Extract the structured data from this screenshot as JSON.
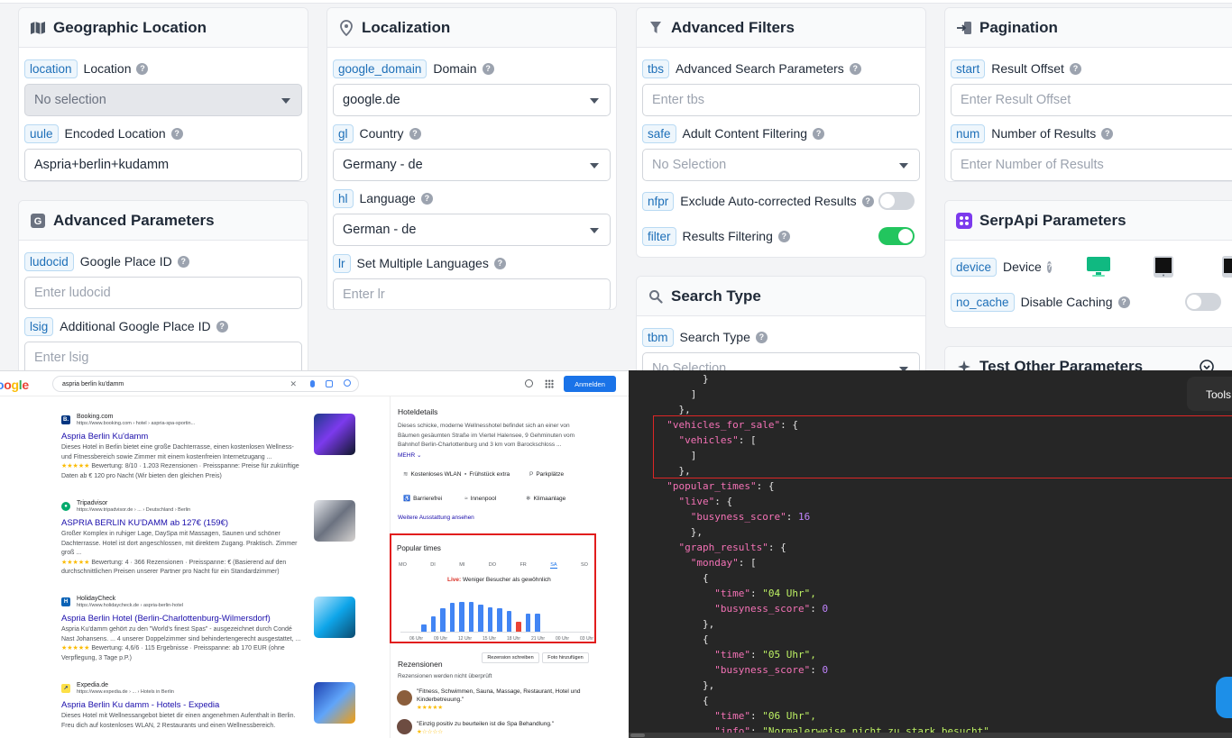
{
  "cards": {
    "geo": {
      "title": "Geographic Location",
      "location_code": "location",
      "location_label": "Location",
      "location_value": "No selection",
      "uule_code": "uule",
      "uule_label": "Encoded Location",
      "uule_value": "Aspria+berlin+kudamm"
    },
    "adv": {
      "title": "Advanced Parameters",
      "ludocid_code": "ludocid",
      "ludocid_label": "Google Place ID",
      "ludocid_placeholder": "Enter ludocid",
      "lsig_code": "lsig",
      "lsig_label": "Additional Google Place ID",
      "lsig_placeholder": "Enter lsig"
    },
    "loc": {
      "title": "Localization",
      "domain_code": "google_domain",
      "domain_label": "Domain",
      "domain_value": "google.de",
      "gl_code": "gl",
      "gl_label": "Country",
      "gl_value": "Germany - de",
      "hl_code": "hl",
      "hl_label": "Language",
      "hl_value": "German - de",
      "lr_code": "lr",
      "lr_label": "Set Multiple Languages",
      "lr_placeholder": "Enter lr"
    },
    "filters": {
      "title": "Advanced Filters",
      "tbs_code": "tbs",
      "tbs_label": "Advanced Search Parameters",
      "tbs_placeholder": "Enter tbs",
      "safe_code": "safe",
      "safe_label": "Adult Content Filtering",
      "safe_value": "No Selection",
      "nfpr_code": "nfpr",
      "nfpr_label": "Exclude Auto-corrected Results",
      "nfpr_on": false,
      "filter_code": "filter",
      "filter_label": "Results Filtering",
      "filter_on": true
    },
    "stype": {
      "title": "Search Type",
      "tbm_code": "tbm",
      "tbm_label": "Search Type",
      "tbm_value": "No Selection"
    },
    "pag": {
      "title": "Pagination",
      "start_code": "start",
      "start_label": "Result Offset",
      "start_placeholder": "Enter Result Offset",
      "num_code": "num",
      "num_label": "Number of Results",
      "num_placeholder": "Enter Number of Results"
    },
    "serpapi": {
      "title": "SerpApi Parameters",
      "device_code": "device",
      "device_label": "Device",
      "nocache_code": "no_cache",
      "nocache_label": "Disable Caching",
      "nocache_on": false
    },
    "test": {
      "title": "Test Other Parameters"
    }
  },
  "serp": {
    "logo": "oogle",
    "query": "aspria berlin ku'damm",
    "signin": "Anmelden",
    "results": [
      {
        "site": "Booking.com",
        "url": "https://www.booking.com › hotel › aspria-spa-sportin...",
        "title": "Aspria Berlin Ku'damm",
        "snippet": "Dieses Hotel in Berlin bietet eine große Dachterrasse, einen kostenlosen Wellness- und Fitnessbereich sowie Zimmer mit einem kostenfreien Internetzugang ...",
        "stars": "★★★★★",
        "meta": "Bewertung: 8/10 · 1.203 Rezensionen · Preisspanne: Preise für zukünftige Daten ab € 120 pro Nacht (Wir bieten den gleichen Preis)"
      },
      {
        "site": "Tripadvisor",
        "url": "https://www.tripadvisor.de › ... › Deutschland › Berlin",
        "title": "ASPRIA BERLIN KU'DAMM ab 127€ (159€)",
        "snippet": "Großer Komplex in ruhiger Lage, DaySpa mit Massagen, Saunen und schöner Dachterrasse. Hotel ist dort angeschlossen, mit direktem Zugang. Praktisch. Zimmer groß ...",
        "stars": "★★★★★",
        "meta": "Bewertung: 4 · 366 Rezensionen · Preisspanne: € (Basierend auf den durchschnittlichen Preisen unserer Partner pro Nacht für ein Standardzimmer)"
      },
      {
        "site": "HolidayCheck",
        "url": "https://www.holidaycheck.de › aspria-berlin-hotel",
        "title": "Aspria Berlin Hotel (Berlin-Charlottenburg-Wilmersdorf)",
        "snippet": "Aspria Ku'damm gehört zu den \"World's finest Spas\" - ausgezeichnet durch Condé Nast Johansens. ... 4 unserer Doppelzimmer sind behindertengerecht ausgestattet, ...",
        "stars": "★★★★★",
        "meta": "Bewertung: 4,6/6 · 115 Ergebnisse · Preisspanne: ab 170 EUR (ohne Verpflegung, 3 Tage p.P.)"
      },
      {
        "site": "Expedia.de",
        "url": "https://www.expedia.de › ... › Hotels in Berlin",
        "title": "Aspria Berlin Ku damm - Hotels - Expedia",
        "snippet": "Dieses Hotel mit Wellnessangebot bietet dir einen angenehmen Aufenthalt in Berlin. Freu dich auf kostenloses WLAN, 2 Restaurants und einen Wellnessbereich.",
        "stars": "",
        "meta": ""
      }
    ],
    "kp": {
      "hotel_title": "Hoteldetails",
      "hotel_desc": "Dieses schicke, moderne Wellnesshotel befindet sich an einer von Bäumen gesäumten Straße im Viertel Halensee, 9 Gehminuten vom Bahnhof Berlin-Charlottenburg und 3 km vom Barockschloss ...",
      "mehr": "MEHR ⌄",
      "amenities": [
        "Kostenloses WLAN",
        "Frühstück extra",
        "Parkplätze",
        "Barrierefrei",
        "Innenpool",
        "Klimaanlage"
      ],
      "more_link": "Weitere Ausstattung ansehen",
      "pop_title": "Popular times",
      "days": [
        "MO",
        "DI",
        "MI",
        "DO",
        "FR",
        "SA",
        "SO"
      ],
      "live_label": "Live:",
      "live_text": "Weniger Besucher als gewöhnlich",
      "bars": [
        0,
        0,
        10,
        22,
        34,
        42,
        44,
        44,
        40,
        36,
        34,
        30,
        14,
        26,
        26,
        0,
        0,
        0,
        0,
        0
      ],
      "live_bar_index": 12,
      "hours": [
        "06 Uhr",
        "09 Uhr",
        "12 Uhr",
        "15 Uhr",
        "18 Uhr",
        "21 Uhr",
        "00 Uhr",
        "03 Uhr"
      ],
      "reviews_title": "Rezensionen",
      "write_review": "Rezension schreiben",
      "add_photo": "Foto hinzufügen",
      "unchecked": "Rezensionen werden nicht überprüft",
      "review1": "\"Fitness, Schwimmen, Sauna, Massage, Restaurant, Hotel und Kinderbetreuung.\"",
      "review2": "\"Einzig positiv zu beurteilen ist die Spa Behandlung.\""
    }
  },
  "json_panel": {
    "tools": "Tools",
    "lines": [
      {
        "t": "        }"
      },
      {
        "t": "      ]"
      },
      {
        "t": "    },"
      },
      {
        "k": "vehicles_for_sale",
        "rest": ": {",
        "indent": "  "
      },
      {
        "k": "vehicles",
        "rest": ": [",
        "indent": "    "
      },
      {
        "t": "      ]"
      },
      {
        "t": "    },"
      },
      {
        "k": "popular_times",
        "rest": ": {",
        "indent": "  "
      },
      {
        "k": "live",
        "rest": ": {",
        "indent": "    "
      },
      {
        "k": "busyness_score",
        "rest": ": ",
        "num": "16",
        "indent": "      "
      },
      {
        "t": "      },"
      },
      {
        "k": "graph_results",
        "rest": ": {",
        "indent": "    "
      },
      {
        "k": "monday",
        "rest": ": [",
        "indent": "      "
      },
      {
        "t": "        {"
      },
      {
        "k": "time",
        "rest": ": ",
        "str": "\"04 Uhr\",",
        "indent": "          "
      },
      {
        "k": "busyness_score",
        "rest": ": ",
        "num": "0",
        "indent": "          "
      },
      {
        "t": "        },"
      },
      {
        "t": "        {"
      },
      {
        "k": "time",
        "rest": ": ",
        "str": "\"05 Uhr\",",
        "indent": "          "
      },
      {
        "k": "busyness_score",
        "rest": ": ",
        "num": "0",
        "indent": "          "
      },
      {
        "t": "        },"
      },
      {
        "t": "        {"
      },
      {
        "k": "time",
        "rest": ": ",
        "str": "\"06 Uhr\",",
        "indent": "          "
      },
      {
        "k": "info",
        "rest": ": ",
        "str": "\"Normalerweise nicht zu stark besucht\",",
        "indent": "          "
      }
    ]
  }
}
